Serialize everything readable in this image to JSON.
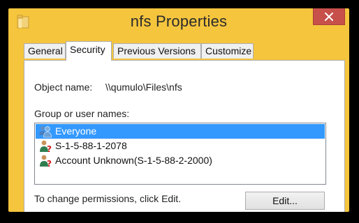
{
  "window": {
    "title": "nfs Properties"
  },
  "tabs": [
    {
      "label": "General"
    },
    {
      "label": "Security"
    },
    {
      "label": "Previous Versions"
    },
    {
      "label": "Customize"
    }
  ],
  "security": {
    "object_name_label": "Object name:",
    "object_name_value": "\\\\qumulo\\Files\\nfs",
    "group_label": "Group or user names:",
    "users": [
      {
        "name": "Everyone",
        "icon": "users-group-icon",
        "selected": true
      },
      {
        "name": "S-1-5-88-1-2078",
        "icon": "unknown-user-icon",
        "selected": false
      },
      {
        "name": "Account Unknown(S-1-5-88-2-2000)",
        "icon": "unknown-user-icon",
        "selected": false
      }
    ],
    "change_text": "To change permissions, click Edit.",
    "edit_label": "Edit..."
  },
  "colors": {
    "title_bar": "#f5c53d",
    "close_button": "#c7504a",
    "selection": "#3399ff"
  }
}
